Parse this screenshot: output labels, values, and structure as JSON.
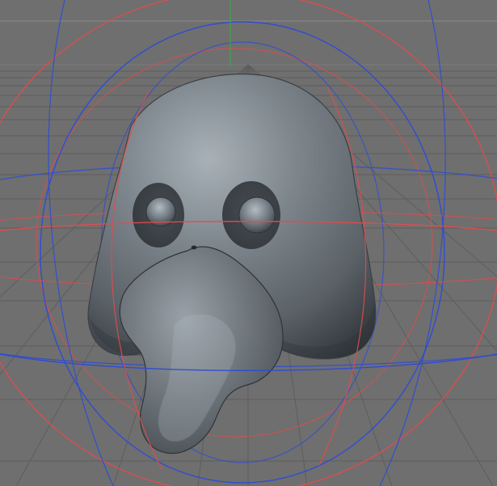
{
  "viewport": {
    "background_color": "#6f6f6f",
    "grid_color": "#5b5b5b",
    "horizon_color": "#8a8a8a",
    "x_axis_guide_color": "#e14b4b",
    "z_axis_guide_color": "#2b4bd8",
    "y_axis_guide_color": "#3fa34d",
    "object_color": "#5a6167",
    "object_highlight_color": "#a9b1b8",
    "object_shadow_color": "#2f3438"
  },
  "scene": {
    "object_name": "",
    "object_type": "bird-head-mesh",
    "selected": true
  }
}
